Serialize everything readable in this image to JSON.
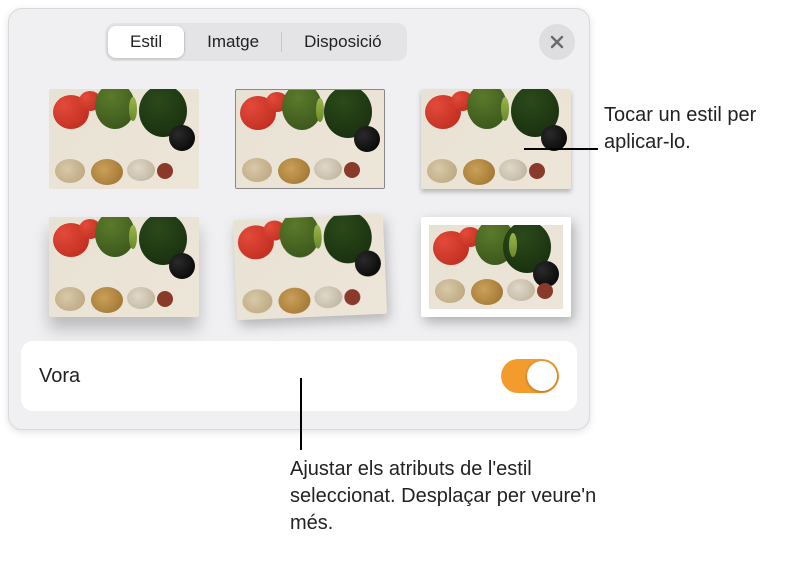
{
  "tabs": {
    "style": "Estil",
    "image": "Imatge",
    "layout": "Disposició"
  },
  "borderRow": {
    "label": "Vora",
    "on": true
  },
  "callouts": {
    "tapStyle": "Tocar un estil per aplicar-lo.",
    "adjust": "Ajustar els atributs de l'estil seleccionat. Desplaçar per veure'n més."
  },
  "styles": [
    {
      "id": "plain"
    },
    {
      "id": "thin-border"
    },
    {
      "id": "shadow"
    },
    {
      "id": "reflection"
    },
    {
      "id": "tilted"
    },
    {
      "id": "polaroid"
    }
  ]
}
